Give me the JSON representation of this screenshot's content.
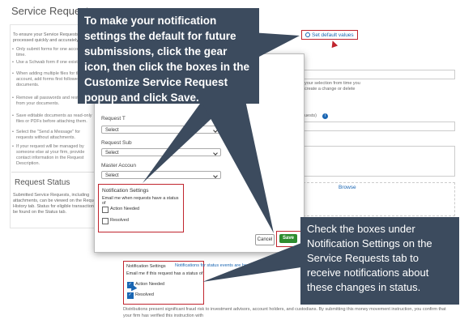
{
  "page": {
    "title": "Service Requests",
    "intro": "To ensure your Service Requests are processed quickly and accurately:",
    "bullets": [
      "Only submit forms for one account at a time.",
      "Use a Schwab form if one exists.",
      "When adding multiple files for the same account, add forms first followed by any documents.",
      "Remove all passwords and restrictions from your documents.",
      "Save editable documents as read-only files or PDFs before attaching them.",
      "Select the \"Send a Message\" for requests without attachments.",
      "If your request will be managed by someone else at your firm, provide contact information in the Request Description."
    ],
    "request_status_title": "Request Status",
    "request_status_text": "Submitted Service Requests, including attachments, can be viewed on the Request History tab. Status for eligible transactions can be found on the Status tab.",
    "request_history_link": "Request History",
    "set_default_label": "Set default values",
    "right_text": "your selection from time you create a change or delete",
    "right_label_2": "uests)",
    "browse_label": "Browse",
    "bottom_text": "Distributions present significant fraud risk to investment advisors, account holders, and custodians. By submitting this money movement instruction, you confirm that your firm has verified this instruction with"
  },
  "modal": {
    "fields": [
      {
        "label": "Request T",
        "value": "Select"
      },
      {
        "label": "Request Sub",
        "value": "Select"
      },
      {
        "label": "Master Accoun",
        "value": "Select"
      }
    ],
    "notification": {
      "title": "Notification Settings",
      "subtitle": "Email me when requests have a status of",
      "options": [
        {
          "label": "Action Needed",
          "checked": false
        },
        {
          "label": "Resolved",
          "checked": false
        }
      ]
    },
    "cancel_label": "Cancel",
    "save_label": "Save"
  },
  "lower_notification": {
    "title": "Notification Settings",
    "link": "Notifications for status events are here!",
    "subtitle": "Email me if this request has a status of",
    "options": [
      {
        "label": "Action Needed",
        "checked": true
      },
      {
        "label": "Resolved",
        "checked": true
      }
    ]
  },
  "callouts": {
    "top": "To make your notification settings the default for future submissions, click the gear icon, then click the boxes in the Customize Service Request popup and click Save.",
    "bottom": "Check the boxes under Notification Settings on the Service Requests tab to receive notifications about these changes in status."
  },
  "colors": {
    "callout_bg": "#3c4b5e",
    "highlight": "#c0252e",
    "save_green": "#2e8b2e",
    "link_blue": "#1a66b3"
  }
}
